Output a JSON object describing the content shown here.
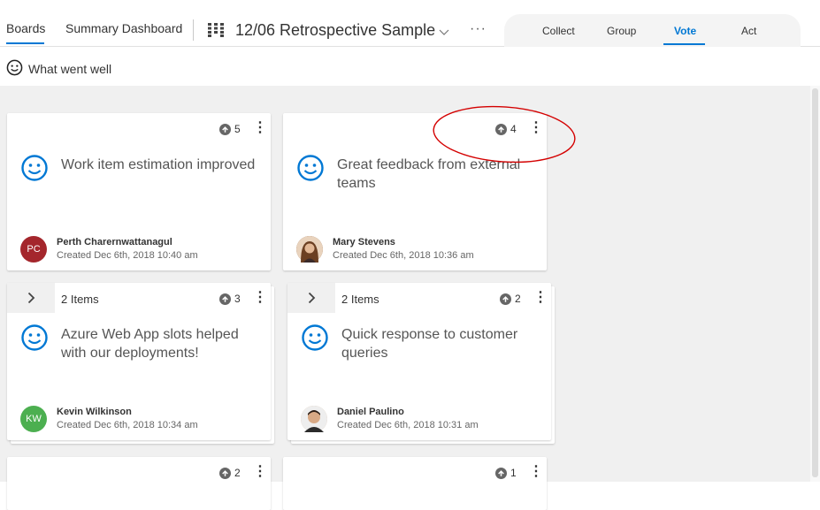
{
  "header": {
    "tab_boards": "Boards",
    "tab_summary": "Summary Dashboard",
    "board_title": "12/06 Retrospective Sample",
    "more": "···",
    "pivots": {
      "collect": "Collect",
      "group": "Group",
      "vote": "Vote",
      "act": "Act"
    },
    "active_pivot": "Vote"
  },
  "column": {
    "title": "What went well",
    "icon": "smiley-icon"
  },
  "colors": {
    "accent": "#0078d4",
    "smile": "#0078d4",
    "annotation": "#d40000"
  },
  "cards": [
    {
      "text": "Work item estimation improved",
      "votes": "5",
      "author": "Perth Charernwattanagul",
      "created": "Created Dec 6th, 2018 10:40 am",
      "avatar_initials": "PC",
      "avatar_color": "#a4262c"
    },
    {
      "text": "Great feedback from external teams",
      "votes": "4",
      "author": "Mary Stevens",
      "created": "Created Dec 6th, 2018 10:36 am",
      "avatar_initials": "",
      "avatar_color": "#7a4a2a"
    },
    {
      "items": "2 Items",
      "text": "Azure Web App slots helped with our deployments!",
      "votes": "3",
      "author": "Kevin Wilkinson",
      "created": "Created Dec 6th, 2018 10:34 am",
      "avatar_initials": "KW",
      "avatar_color": "#4caf50"
    },
    {
      "items": "2 Items",
      "text": "Quick response to customer queries",
      "votes": "2",
      "author": "Daniel Paulino",
      "created": "Created Dec 6th, 2018 10:31 am",
      "avatar_initials": "",
      "avatar_color": "#c9a17d"
    },
    {
      "votes": "2"
    },
    {
      "votes": "1"
    }
  ]
}
